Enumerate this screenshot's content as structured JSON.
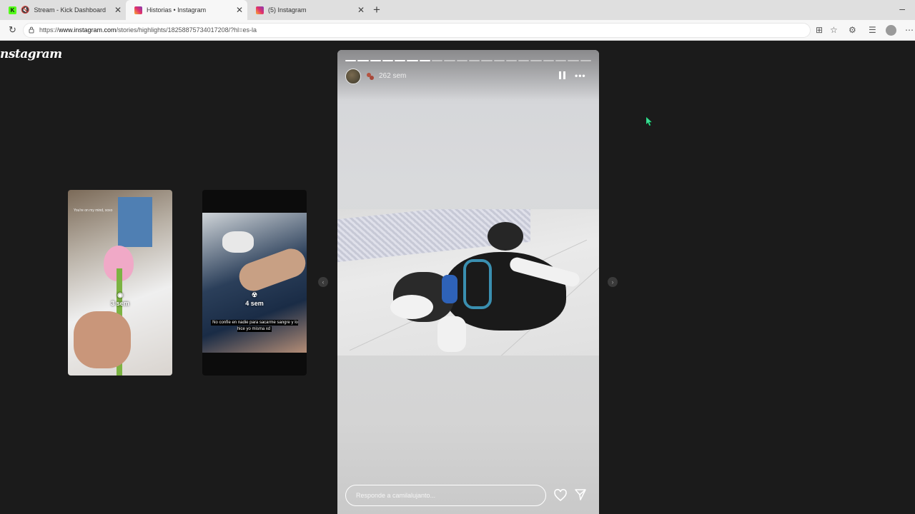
{
  "browser": {
    "tabs": [
      {
        "title": "Stream - Kick Dashboard",
        "favicon": "kick-icon",
        "muted": true,
        "active": false
      },
      {
        "title": "Historias • Instagram",
        "favicon": "instagram-icon",
        "active": true
      },
      {
        "title": "(5) Instagram",
        "favicon": "instagram-icon",
        "active": false
      }
    ],
    "url_prefix": "https://",
    "url_host": "www.instagram.com",
    "url_path": "/stories/highlights/18258875734017208/?hl=es-la"
  },
  "page": {
    "logo_text": "nstagram",
    "side_stories": [
      {
        "time": "3 sem",
        "caption": "You're on my mind, xoxo"
      },
      {
        "time": "4 sem",
        "caption": "No confíe en nadie para sacarme sangre y lo hice yo misma xd"
      }
    ],
    "story": {
      "time": "262 sem",
      "segments_total": 20,
      "segments_done": 7,
      "reply_placeholder": "Responde a camilalujanto..."
    }
  },
  "colors": {
    "page_bg": "#1b1b1b",
    "story_bg": "#d6d7da",
    "accent_kick": "#53fc18"
  }
}
